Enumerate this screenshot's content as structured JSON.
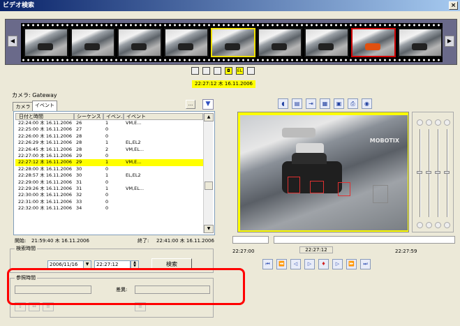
{
  "window": {
    "title": "ビデオ検索",
    "close": "×"
  },
  "filmstrip": {
    "left_arrow": "◀",
    "right_arrow": "▶",
    "frames": 9,
    "selected_index": 4,
    "marked_index": 7
  },
  "controls": {
    "icons": [
      "square-icon",
      "square-icon",
      "square-icon",
      "camera-icon",
      "el-icon",
      "square-icon"
    ],
    "el_label": "EL",
    "timestamp": "22:27:12 木 16.11.2006"
  },
  "camera": {
    "label": "カメラ: Gateway"
  },
  "tabs": {
    "camera": "カメラ",
    "event": "イベント"
  },
  "list_toolbar": {
    "more": "...",
    "filter_icon": "funnel-icon"
  },
  "table": {
    "headers": [
      "日付と時間",
      "シーケンス",
      "イベン...",
      "イベント"
    ],
    "rows": [
      [
        "22:24:00 木 16.11.2006",
        "26",
        "1",
        "VM,E..."
      ],
      [
        "22:25:00 木 16.11.2006",
        "27",
        "0",
        ""
      ],
      [
        "22:26:00 木 16.11.2006",
        "28",
        "0",
        ""
      ],
      [
        "22:26:29 木 16.11.2006",
        "28",
        "1",
        "EL,EL2"
      ],
      [
        "22:26:45 木 16.11.2006",
        "28",
        "2",
        "VM,EL..."
      ],
      [
        "22:27:00 木 16.11.2006",
        "29",
        "0",
        ""
      ],
      [
        "22:27:12 木 16.11.2006",
        "29",
        "1",
        "VM,E..."
      ],
      [
        "22:28:00 木 16.11.2006",
        "30",
        "0",
        ""
      ],
      [
        "22:28:57 木 16.11.2006",
        "30",
        "1",
        "EL,EL2"
      ],
      [
        "22:29:00 木 16.11.2006",
        "31",
        "0",
        ""
      ],
      [
        "22:29:26 木 16.11.2006",
        "31",
        "1",
        "VM,EL..."
      ],
      [
        "22:30:00 木 16.11.2006",
        "32",
        "0",
        ""
      ],
      [
        "22:31:00 木 16.11.2006",
        "33",
        "0",
        ""
      ],
      [
        "22:32:00 木 16.11.2006",
        "34",
        "0",
        ""
      ]
    ],
    "highlight_row": 6,
    "scroll_up": "▲",
    "scroll_down": "▼"
  },
  "range": {
    "start_label": "開始:",
    "start_value": "21:59:40 木 16.11.2006",
    "end_label": "終了:",
    "end_value": "22:41:00 木 16.11.2006"
  },
  "search": {
    "group_title": "検索時間",
    "date": "2006/11/16",
    "time": "22:27:12",
    "button": "検索",
    "dropdown": "▼",
    "spin_up": "▲",
    "spin_down": "▼"
  },
  "reference": {
    "group_title": "参照時間",
    "delta_label": "差異:"
  },
  "playback": {
    "start_time": "22:27:00",
    "current_time": "22:27:12",
    "end_time": "22:27:59"
  },
  "video": {
    "watermark": "MOBOTIX"
  },
  "colors": {
    "highlight": "#ffff00",
    "annotation_red": "#ff0000",
    "titlebar": "#0a246a"
  }
}
